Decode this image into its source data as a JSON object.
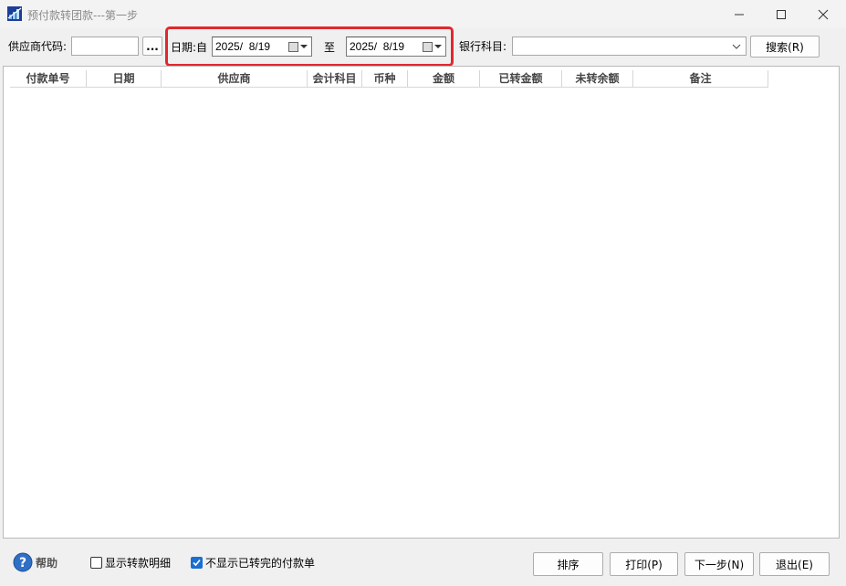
{
  "window": {
    "title": "预付款转团款---第一步",
    "icon": "app-chart-icon",
    "controls": [
      "minimize-icon",
      "maximize-icon",
      "close-icon"
    ]
  },
  "toolbar": {
    "supplier_label": "供应商代码:",
    "supplier_value": "",
    "browse_label": "...",
    "date_label": "日期:自",
    "date_from": "2025/  8/19",
    "to_label": "至",
    "date_to": "2025/  8/19",
    "bank_label": "银行科目:",
    "bank_value": "",
    "search_label": "搜索(R)"
  },
  "table": {
    "columns": [
      "付款单号",
      "日期",
      "供应商",
      "会计科目",
      "币种",
      "金额",
      "已转金额",
      "未转余额",
      "备注"
    ],
    "rows": []
  },
  "footer": {
    "help_label": "帮助",
    "show_detail_label": "显示转款明细",
    "show_detail_checked": false,
    "hide_done_label": "不显示已转完的付款单",
    "hide_done_checked": true,
    "sort_label": "排序",
    "print_label": "打印(P)",
    "next_label": "下一步(N)",
    "exit_label": "退出(E)"
  },
  "colors": {
    "highlight": "#e0282e",
    "checkbox_on": "#1a6fd0",
    "help_icon": "#2f6fc5"
  }
}
